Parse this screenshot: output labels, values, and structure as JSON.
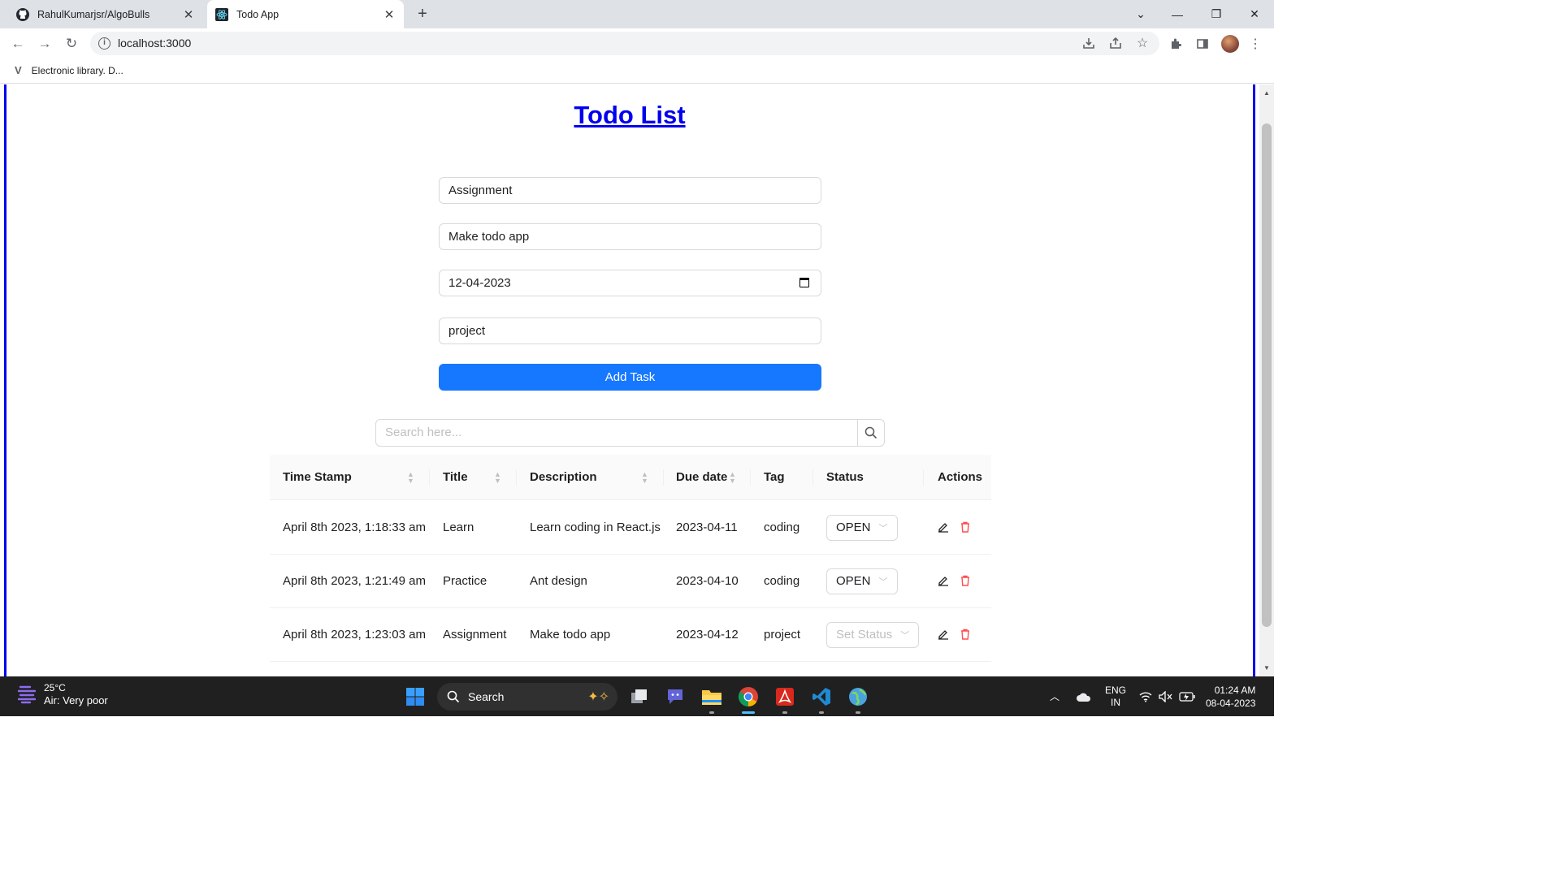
{
  "browser": {
    "tabs": [
      {
        "label": "RahulKumarjsr/AlgoBulls",
        "icon": "github-icon",
        "active": false
      },
      {
        "label": "Todo App",
        "icon": "react-icon",
        "active": true
      }
    ],
    "url": "localhost:3000",
    "bookmark": "Electronic library. D..."
  },
  "app": {
    "title": "Todo List",
    "form": {
      "title_value": "Assignment",
      "description_value": "Make todo app",
      "due_date_value": "12-04-2023",
      "tag_value": "project",
      "submit_label": "Add Task"
    },
    "search": {
      "placeholder": "Search here..."
    },
    "table": {
      "columns": [
        "Time Stamp",
        "Title",
        "Description",
        "Due date",
        "Tag",
        "Status",
        "Actions"
      ],
      "rows": [
        {
          "timestamp": "April 8th 2023, 1:18:33 am",
          "title": "Learn",
          "description": "Learn coding in React.js",
          "due": "2023-04-11",
          "tag": "coding",
          "status": "OPEN"
        },
        {
          "timestamp": "April 8th 2023, 1:21:49 am",
          "title": "Practice",
          "description": "Ant design",
          "due": "2023-04-10",
          "tag": "coding",
          "status": "OPEN"
        },
        {
          "timestamp": "April 8th 2023, 1:23:03 am",
          "title": "Assignment",
          "description": "Make todo app",
          "due": "2023-04-12",
          "tag": "project",
          "status": "Set Status"
        }
      ]
    }
  },
  "taskbar": {
    "weather_temp": "25°C",
    "weather_desc": "Air: Very poor",
    "search_label": "Search",
    "lang_top": "ENG",
    "lang_bottom": "IN",
    "time": "01:24 AM",
    "date": "08-04-2023"
  },
  "colors": {
    "primary": "#1677ff",
    "link": "#0000ee",
    "danger": "#ff4d4f"
  }
}
